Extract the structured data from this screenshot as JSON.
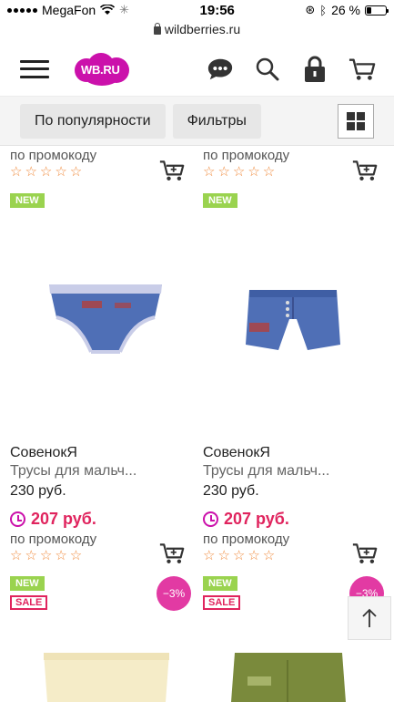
{
  "status": {
    "carrier": "MegaFon",
    "time": "19:56",
    "battery": "26 %",
    "battery_level": 0.26
  },
  "browser": {
    "url": "wildberries.ru"
  },
  "header": {
    "logo_text": "WB.RU",
    "brand_color": "#cb11ab"
  },
  "filters": {
    "sort_label": "По популярности",
    "filters_label": "Фильтры"
  },
  "top_row": [
    {
      "promo": "по промокоду",
      "stars": "☆☆☆☆☆",
      "badge": "NEW"
    },
    {
      "promo": "по промокоду",
      "stars": "☆☆☆☆☆",
      "badge": "NEW"
    }
  ],
  "products": [
    {
      "brand": "СовенокЯ",
      "title": "Трусы для мальч...",
      "old_price": "230 руб.",
      "price": "207 руб.",
      "promo": "по промокоду",
      "stars": "☆☆☆☆☆",
      "badge_new": "NEW",
      "badge_sale": "SALE",
      "discount": "−3%"
    },
    {
      "brand": "СовенокЯ",
      "title": "Трусы для мальч...",
      "old_price": "230 руб.",
      "price": "207 руб.",
      "promo": "по промокоду",
      "stars": "☆☆☆☆☆",
      "badge_new": "NEW",
      "badge_sale": "SALE",
      "discount": "−3%"
    }
  ]
}
